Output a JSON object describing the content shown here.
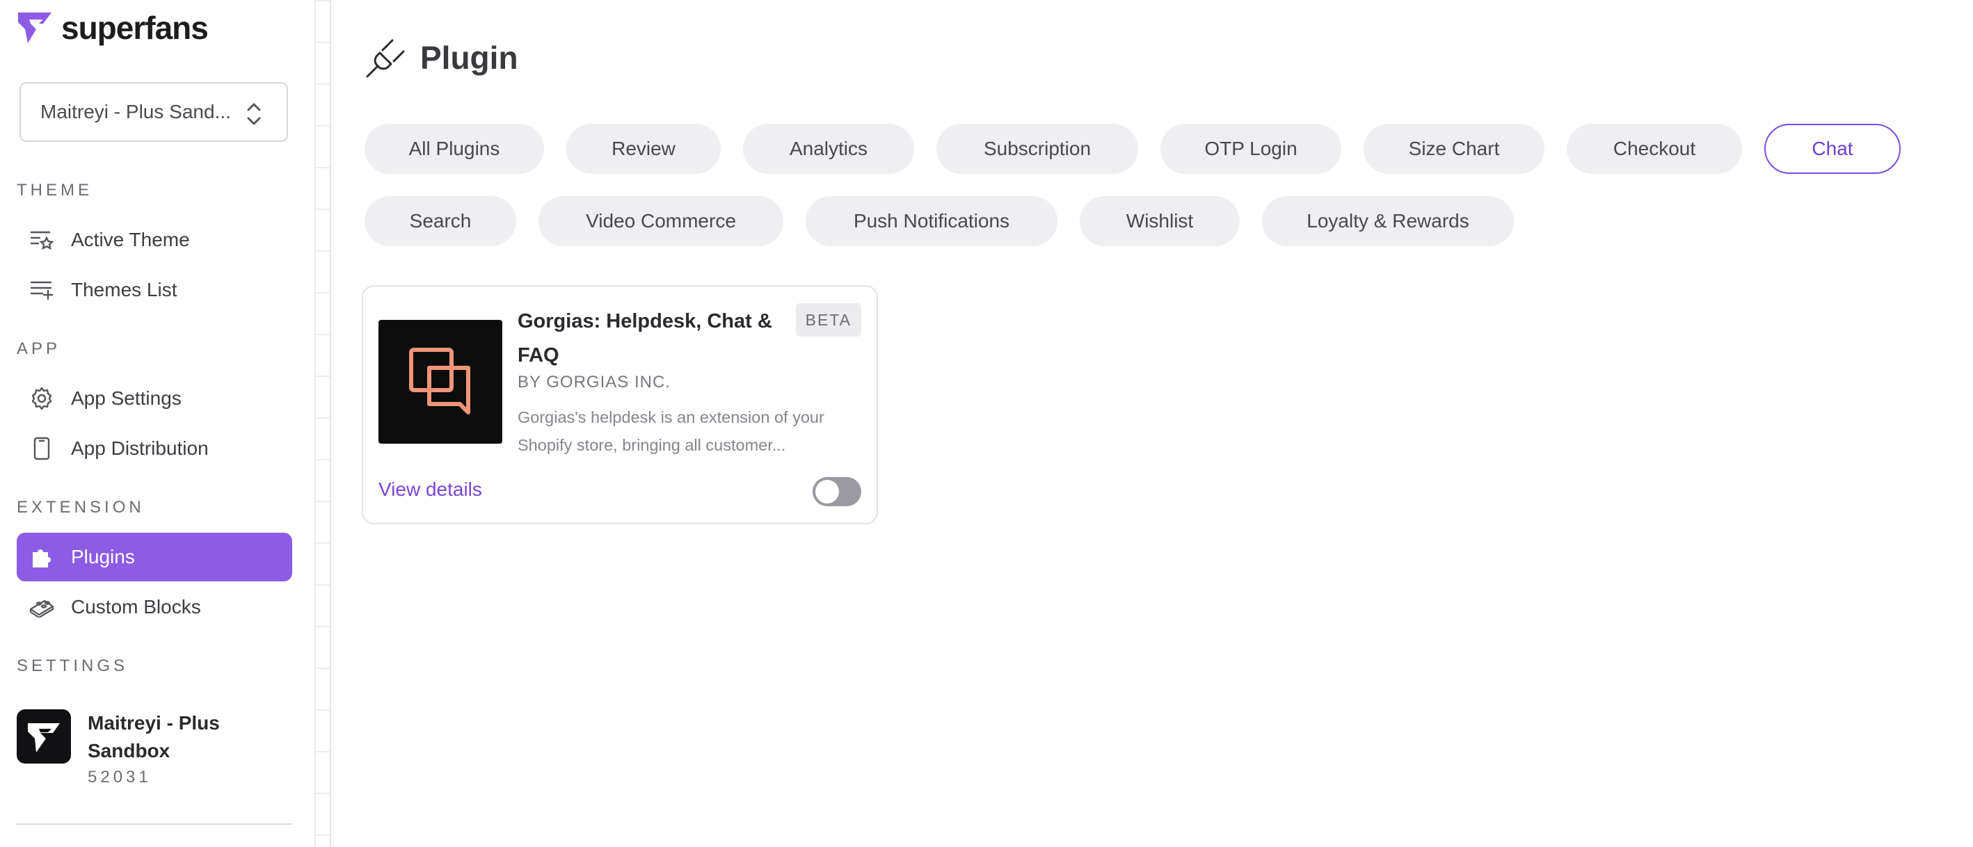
{
  "brand": {
    "name": "superfans",
    "accent": "#8d5be4"
  },
  "store_selector": {
    "value": "Maitreyi - Plus Sand..."
  },
  "sidebar": {
    "sections": [
      {
        "label": "THEME",
        "items": [
          {
            "label": "Active Theme",
            "icon": "theme-star-icon",
            "active": false
          },
          {
            "label": "Themes List",
            "icon": "list-add-icon",
            "active": false
          }
        ]
      },
      {
        "label": "APP",
        "items": [
          {
            "label": "App Settings",
            "icon": "gear-icon",
            "active": false
          },
          {
            "label": "App Distribution",
            "icon": "phone-icon",
            "active": false
          }
        ]
      },
      {
        "label": "EXTENSION",
        "items": [
          {
            "label": "Plugins",
            "icon": "puzzle-icon",
            "active": true
          },
          {
            "label": "Custom Blocks",
            "icon": "blocks-icon",
            "active": false
          }
        ]
      },
      {
        "label": "SETTINGS",
        "items": []
      }
    ]
  },
  "account": {
    "name": "Maitreyi - Plus Sandbox",
    "id": "52031"
  },
  "page": {
    "title": "Plugin",
    "icon": "plug-icon"
  },
  "filters": [
    {
      "label": "All Plugins",
      "active": false
    },
    {
      "label": "Review",
      "active": false
    },
    {
      "label": "Analytics",
      "active": false
    },
    {
      "label": "Subscription",
      "active": false
    },
    {
      "label": "OTP Login",
      "active": false
    },
    {
      "label": "Size Chart",
      "active": false
    },
    {
      "label": "Checkout",
      "active": false
    },
    {
      "label": "Chat",
      "active": true
    },
    {
      "label": "Search",
      "active": false
    },
    {
      "label": "Video Commerce",
      "active": false
    },
    {
      "label": "Push Notifications",
      "active": false
    },
    {
      "label": "Wishlist",
      "active": false
    },
    {
      "label": "Loyalty & Rewards",
      "active": false
    }
  ],
  "plugins": [
    {
      "title": "Gorgias: Helpdesk, Chat & FAQ",
      "badge": "BETA",
      "vendor": "BY GORGIAS INC.",
      "description": "Gorgias's helpdesk is an extension of your Shopify store, bringing all customer...",
      "link_label": "View details",
      "enabled": false,
      "logo_color": "#f0957a"
    }
  ]
}
